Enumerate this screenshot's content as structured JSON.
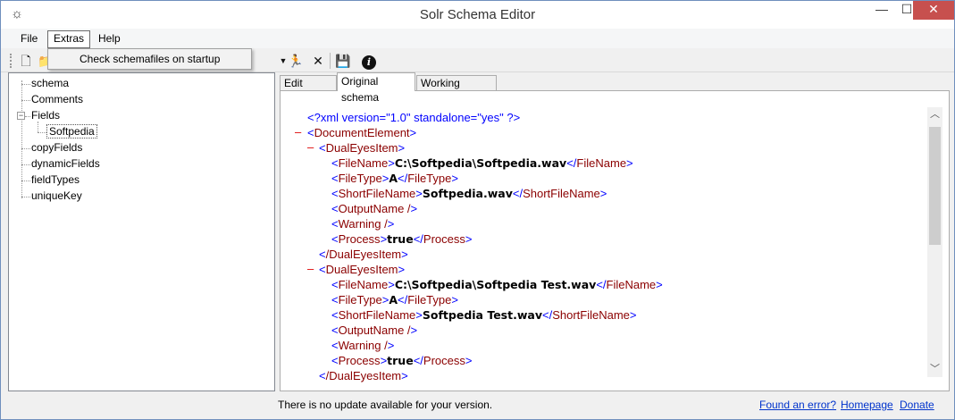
{
  "window": {
    "title": "Solr Schema Editor",
    "app_icon": "gear-icon",
    "minimize": "—",
    "maximize": "☐",
    "close": "✕"
  },
  "menu": {
    "file": "File",
    "extras": "Extras",
    "help": "Help",
    "extras_items": [
      "Check schemafiles on startup"
    ]
  },
  "toolbar": {
    "new_icon": "🗋",
    "open_icon": "📁",
    "dropdown_icon": "▼",
    "run_icon": "🏃",
    "stop_icon": "✕",
    "save_icon": "💾",
    "info_icon": "i"
  },
  "tree": {
    "nodes": [
      {
        "label": "schema"
      },
      {
        "label": "Comments"
      },
      {
        "label": "Fields",
        "expander": "−"
      },
      {
        "label": "Softpedia"
      },
      {
        "label": "copyFields"
      },
      {
        "label": "dynamicFields"
      },
      {
        "label": "fieldTypes"
      },
      {
        "label": "uniqueKey"
      }
    ]
  },
  "tabs": {
    "edit_details": "Edit Details",
    "original_schema": "Original schema",
    "working_schema": "Working schema"
  },
  "xml": {
    "decl": "<?xml version=\"1.0\" standalone=\"yes\" ?>",
    "root_open": "DocumentElement",
    "item_open": "DualEyesItem",
    "item_close": "/DualEyesItem",
    "filename_tag": "FileName",
    "filetype_tag": "FileType",
    "shortfilename_tag": "ShortFileName",
    "outputname_empty": "OutputName /",
    "warning_empty": "Warning /",
    "process_tag": "Process",
    "items": [
      {
        "filename": "C:\\Softpedia\\Softpedia.wav",
        "filetype": "A",
        "shortfilename": "Softpedia.wav",
        "process": "true"
      },
      {
        "filename": "C:\\Softpedia\\Softpedia Test.wav",
        "filetype": "A",
        "shortfilename": "Softpedia Test.wav",
        "process": "true"
      }
    ]
  },
  "status": {
    "message": "There is no update available for your version.",
    "link_error": "Found an error?",
    "link_homepage": "Homepage",
    "link_donate": "Donate"
  }
}
